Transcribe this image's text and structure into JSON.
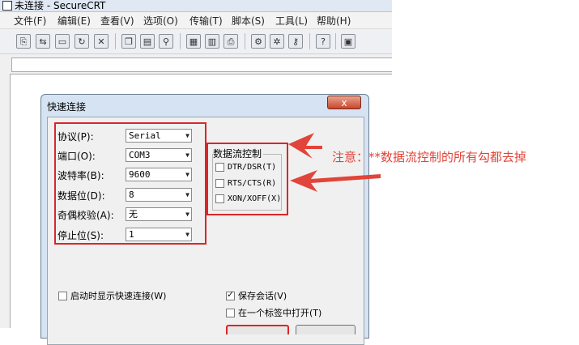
{
  "window": {
    "title": "未连接 - SecureCRT"
  },
  "menu": [
    "文件(F)",
    "编辑(E)",
    "查看(V)",
    "选项(O)",
    "传输(T)",
    "脚本(S)",
    "工具(L)",
    "帮助(H)"
  ],
  "toolbar_icons": [
    "connect-icon",
    "quick-connect-icon",
    "connect-tab-icon",
    "reconnect-icon",
    "disconnect-icon",
    "copy-icon",
    "paste-icon",
    "find-icon",
    "print-setup-icon",
    "print-selection-icon",
    "print-icon",
    "session-options-icon",
    "global-options-icon",
    "keymap-icon",
    "help-icon",
    "sftp-icon"
  ],
  "dialog": {
    "title": "快速连接",
    "close_label": "x",
    "fields": [
      {
        "label": "协议(P):",
        "value": "Serial"
      },
      {
        "label": "端口(O):",
        "value": "COM3"
      },
      {
        "label": "波特率(B):",
        "value": "9600"
      },
      {
        "label": "数据位(D):",
        "value": "8"
      },
      {
        "label": "奇偶校验(A):",
        "value": "无"
      },
      {
        "label": "停止位(S):",
        "value": "1"
      }
    ],
    "flow_control": {
      "title": "数据流控制",
      "options": [
        {
          "label": "DTR/DSR(T)",
          "checked": false
        },
        {
          "label": "RTS/CTS(R)",
          "checked": false
        },
        {
          "label": "XON/XOFF(X)",
          "checked": false
        }
      ]
    },
    "show_on_startup": {
      "label": "启动时显示快速连接(W)",
      "checked": false
    },
    "save_session": {
      "label": "保存会话(V)",
      "checked": true
    },
    "open_in_tab": {
      "label": "在一个标签中打开(T)",
      "checked": false
    }
  },
  "annotation": {
    "note": "注意：**数据流控制的所有勾都去掉",
    "color": "#e1443a"
  }
}
